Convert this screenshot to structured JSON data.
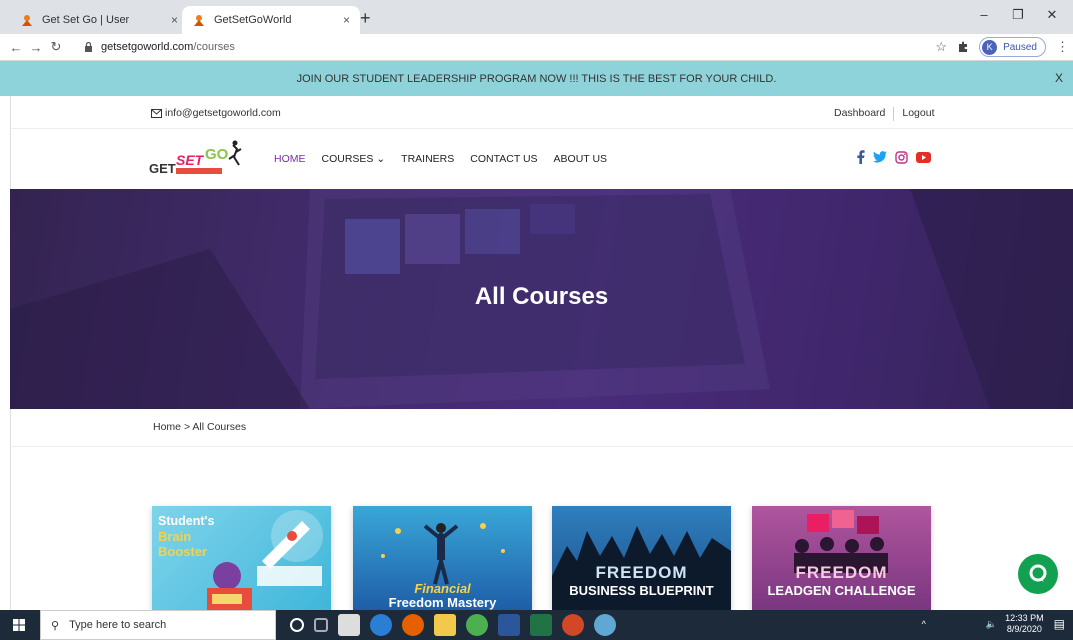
{
  "browser": {
    "tabs": [
      {
        "title": "Get Set Go | User",
        "active": false
      },
      {
        "title": "GetSetGoWorld",
        "active": true
      }
    ],
    "url_host": "getsetgoworld.com",
    "url_path": "/courses",
    "profile_initial": "K",
    "profile_label": "Paused",
    "new_tab": "+",
    "close_tab": "×",
    "win_minimize": "–",
    "win_restore": "❐",
    "win_close": "✕"
  },
  "announcement": {
    "text": "JOIN OUR STUDENT LEADERSHIP PROGRAM NOW !!! THIS IS THE BEST FOR YOUR CHILD.",
    "close": "X"
  },
  "topbar": {
    "email": "info@getsetgoworld.com",
    "links": [
      "Dashboard",
      "Logout"
    ]
  },
  "nav": {
    "items": [
      "HOME",
      "COURSES",
      "TRAINERS",
      "CONTACT US",
      "ABOUT US"
    ],
    "courses_caret": "⌄"
  },
  "hero": {
    "title": "All Courses"
  },
  "breadcrumb": {
    "home": "Home",
    "sep": ">",
    "current": "All Courses"
  },
  "courses": [
    {
      "line1": "Student's",
      "line2": "Brain",
      "line3": "Booster"
    },
    {
      "line1": "Financial",
      "line2": "Freedom Mastery"
    },
    {
      "line1": "FREEDOM",
      "line2": "BUSINESS BLUEPRINT"
    },
    {
      "line1": "FREEDOM",
      "line2": "LEADGEN CHALLENGE"
    }
  ],
  "taskbar": {
    "search_placeholder": "Type here to search",
    "time": "12:33 PM",
    "date": "8/9/2020"
  },
  "colors": {
    "announcement": "#8fd3da",
    "nav_active": "#7a2fa0",
    "chat": "#12a150",
    "taskbar": "#1c2a3a"
  }
}
